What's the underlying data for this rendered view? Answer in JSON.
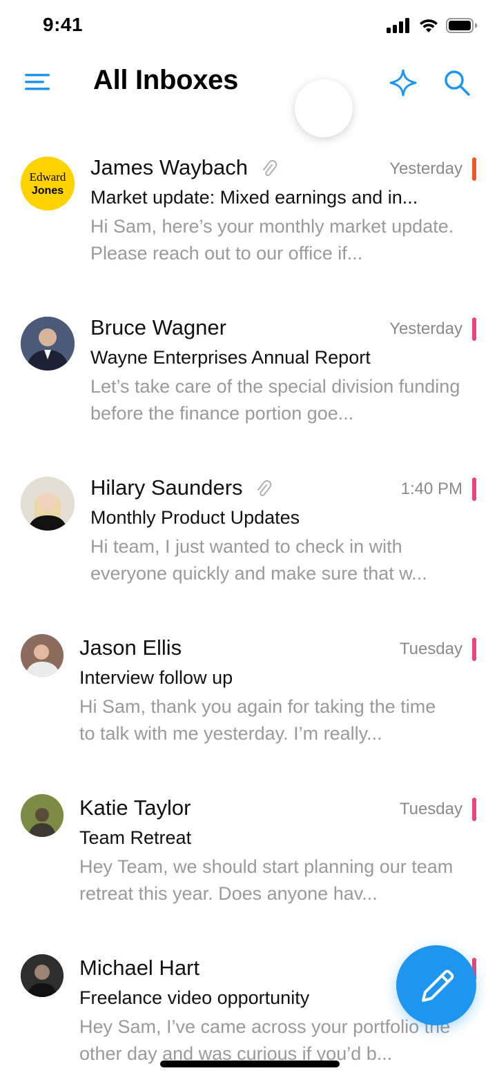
{
  "status_bar": {
    "time": "9:41"
  },
  "header": {
    "title": "All Inboxes",
    "accent_color": "#1E96F0"
  },
  "emails": [
    {
      "sender": "James Waybach",
      "has_attachment": true,
      "time": "Yesterday",
      "subject": "Market update: Mixed earnings and in...",
      "preview": "Hi Sam, here’s your monthly market update. Please reach out to our office if...",
      "flag_color": "#F05A28",
      "avatar": {
        "line1": "Edward",
        "line2": "Jones",
        "bg": "#FFD200"
      }
    },
    {
      "sender": "Bruce Wagner",
      "has_attachment": false,
      "time": "Yesterday",
      "subject": "Wayne Enterprises Annual Report",
      "preview": "Let’s take care of the special division funding before the finance portion goe...",
      "flag_color": "#E8457A",
      "avatar": {
        "bg": "#3b4a66"
      }
    },
    {
      "sender": "Hilary Saunders",
      "has_attachment": true,
      "time": "1:40 PM",
      "subject": "Monthly Product Updates",
      "preview": "Hi team, I just wanted to check in with everyone quickly and make sure that w...",
      "flag_color": "#E8457A",
      "avatar": {
        "bg": "#d9cfc4"
      }
    },
    {
      "sender": "Jason Ellis",
      "has_attachment": false,
      "time": "Tuesday",
      "subject": "Interview follow up",
      "preview": "Hi Sam, thank you again for taking the time to talk with me yesterday. I’m really...",
      "flag_color": "#E8457A",
      "avatar": {
        "bg": "#c9a896"
      }
    },
    {
      "sender": "Katie Taylor",
      "has_attachment": false,
      "time": "Tuesday",
      "subject": "Team Retreat",
      "preview": "Hey Team, we should start planning our team retreat this year. Does anyone hav...",
      "flag_color": "#E8457A",
      "avatar": {
        "bg": "#6b7a3a"
      }
    },
    {
      "sender": "Michael Hart",
      "has_attachment": false,
      "time": "",
      "subject": "Freelance video opportunity",
      "preview": "Hey Sam, I’ve came across your portfolio the other day and was curious if you’d b...",
      "flag_color": "#E8457A",
      "avatar": {
        "bg": "#2b2b2b"
      }
    }
  ],
  "fab": {
    "icon": "pencil-icon",
    "color": "#1E96F0"
  },
  "icons": {
    "menu": "hamburger-menu-icon",
    "ai": "sparkle-icon",
    "search": "search-icon",
    "attachment": "paperclip-icon"
  }
}
